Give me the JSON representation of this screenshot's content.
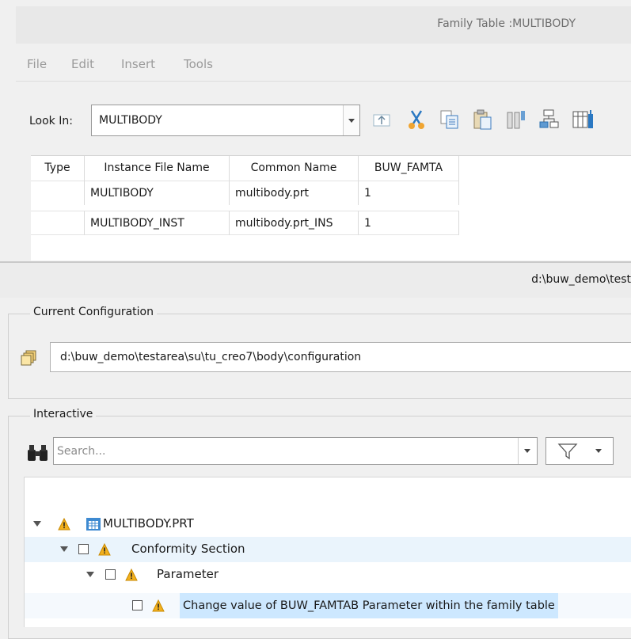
{
  "family_table": {
    "title": "Family Table :MULTIBODY",
    "menu": [
      "File",
      "Edit",
      "Insert",
      "Tools"
    ],
    "look_in_label": "Look In:",
    "look_in_value": "MULTIBODY",
    "columns": [
      "Type",
      "Instance File Name",
      "Common Name",
      "BUW_FAMTA"
    ],
    "rows": [
      [
        "",
        "MULTIBODY",
        "multibody.prt",
        "1"
      ],
      [
        "",
        "MULTIBODY_INST",
        "multibody.prt_INS",
        "1"
      ]
    ]
  },
  "checker": {
    "path_header": "d:\\buw_demo\\test",
    "current_configuration": {
      "legend": "Current Configuration",
      "path": "d:\\buw_demo\\testarea\\su\\tu_creo7\\body\\configuration"
    },
    "interactive": {
      "legend": "Interactive",
      "search_placeholder": "Search...",
      "tree": {
        "root": "MULTIBODY.PRT",
        "section": "Conformity Section",
        "group": "Parameter",
        "item": "Change value of BUW_FAMTAB Parameter within the  family table"
      }
    }
  },
  "colors": {
    "selection": "#cde8ff",
    "row_highlight": "#eaf4fc",
    "warning": "#f2b01e"
  }
}
